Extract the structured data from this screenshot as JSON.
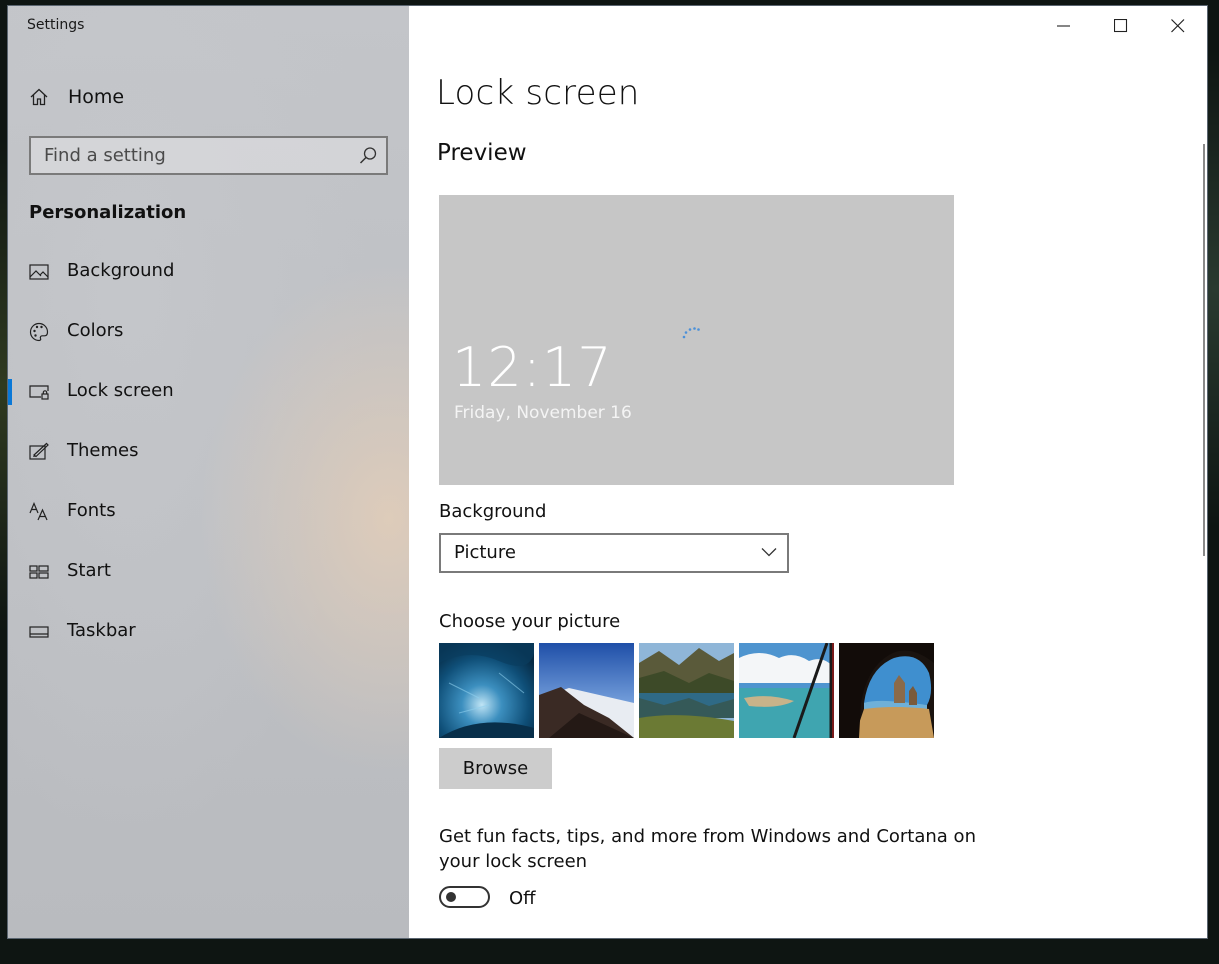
{
  "window": {
    "title": "Settings"
  },
  "sidebar": {
    "home_label": "Home",
    "search_placeholder": "Find a setting",
    "section_title": "Personalization",
    "items": [
      {
        "label": "Background",
        "icon": "picture-icon",
        "selected": false
      },
      {
        "label": "Colors",
        "icon": "palette-icon",
        "selected": false
      },
      {
        "label": "Lock screen",
        "icon": "lock-screen-icon",
        "selected": true
      },
      {
        "label": "Themes",
        "icon": "themes-icon",
        "selected": false
      },
      {
        "label": "Fonts",
        "icon": "fonts-icon",
        "selected": false
      },
      {
        "label": "Start",
        "icon": "start-icon",
        "selected": false
      },
      {
        "label": "Taskbar",
        "icon": "taskbar-icon",
        "selected": false
      }
    ]
  },
  "main": {
    "title": "Lock screen",
    "preview_heading": "Preview",
    "preview": {
      "time": "12:17",
      "date": "Friday, November 16"
    },
    "background_label": "Background",
    "background_value": "Picture",
    "choose_picture_label": "Choose your picture",
    "pictures": [
      "ice-cave",
      "mountain-sky",
      "lake-reflection",
      "beach-window",
      "cave-arch"
    ],
    "browse_label": "Browse",
    "tips_text": "Get fun facts, tips, and more from Windows and Cortana on your lock screen",
    "tips_toggle_state": "Off"
  },
  "colors": {
    "accent": "#0a78d7",
    "preview_bg": "#c6c6c6"
  }
}
